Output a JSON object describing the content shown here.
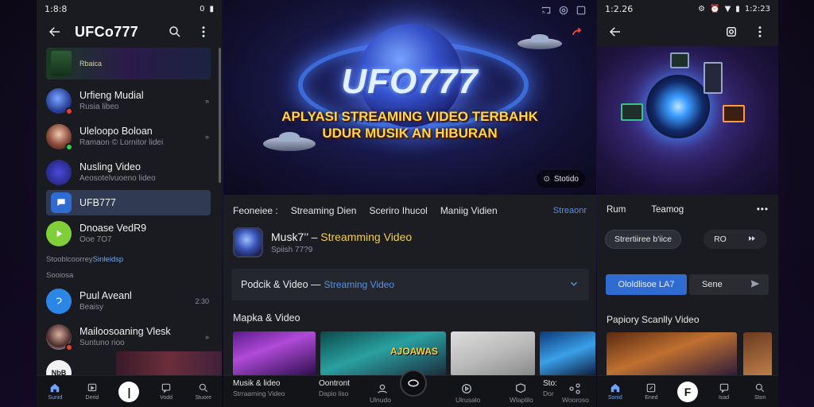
{
  "colors": {
    "accent": "#2f6bd0",
    "highlight": "#f1d04a",
    "link": "#5c8fe0",
    "panel": "#1c1d22"
  },
  "left": {
    "status_time": "1:8:8",
    "status_icons": "0",
    "title": "UFCo777",
    "banner_label": "Rbaica",
    "items": [
      {
        "title": "Urfieng Mudial",
        "sub": "Rusia libeo",
        "meta": "»"
      },
      {
        "title": "Uleloopo Boloan",
        "sub": "Ramaon © Lornitor lidei",
        "meta": "»"
      },
      {
        "title": "Nusling Video",
        "sub": "Aeosotelvuoeno lideo",
        "meta": ""
      },
      {
        "title": "UFB777",
        "sub": "",
        "meta": ""
      },
      {
        "title": "Dnoase VedR9",
        "sub": "Ooe 7O7",
        "meta": ""
      }
    ],
    "line1_a": "Stooblcoorrey ",
    "line1_b": "Sinleidsp",
    "line2": "Sooiosa",
    "items2": [
      {
        "title": "Puul Aveanl",
        "sub": "Beaisy",
        "meta": "2:30"
      },
      {
        "title": "Mailoosoaning Vlesk",
        "sub": "Suntuno rioo",
        "meta": "»"
      },
      {
        "title": "",
        "sub": "",
        "meta": ""
      }
    ],
    "avatar_text": "NbB",
    "nav": [
      "Sunid",
      "Derid",
      "",
      "Vodd",
      "Stuore"
    ]
  },
  "center": {
    "logo": "UFO777",
    "tagline1": "APLYASI STREAMING VIDEO TERBAHK",
    "tagline2": "UDUR MUSIK AN HIBURAN",
    "corner_label": "Stotido",
    "tabs": [
      "Feoneiee :",
      "Streaming Dien",
      "Sceriro Ihucol",
      "Maniig Vidien"
    ],
    "tab_more": "Streaonr",
    "app_title_a": "Musk7’’ – ",
    "app_title_b": "Streamming Video",
    "app_sub": "Spiish 77?9",
    "dropdown_a": "Podcik & Video — ",
    "dropdown_b": "Streaming Video",
    "section": "Mapka & Video",
    "thumb_mark": "AJOAWAS",
    "bottom": [
      {
        "title": "Musik & lideo",
        "sub": "Strraaming Video"
      },
      {
        "title": "Oontront",
        "sub": "Dapio liso"
      },
      {
        "title": "",
        "sub": "Ulnudo"
      },
      {
        "title": "",
        "sub": "Ulrusalo"
      },
      {
        "title": "",
        "sub": "Wlaplilo"
      },
      {
        "title": "Sto:",
        "sub": "Dor"
      },
      {
        "title": "",
        "sub": "Wooroso"
      }
    ]
  },
  "right": {
    "status_time": "1:2.26",
    "status_right": "1:2:23",
    "tab1": "Rum",
    "tab2": "Teamog",
    "pill1": "Strertiiree b'iice",
    "pill2": "RO",
    "btn_primary": "Ololdlisoe LA7",
    "btn_secondary": "Sene",
    "section": "Papiory Scanlly Video",
    "nav": [
      "Sonid",
      "Ened",
      "",
      "Isad",
      "Ston"
    ]
  }
}
